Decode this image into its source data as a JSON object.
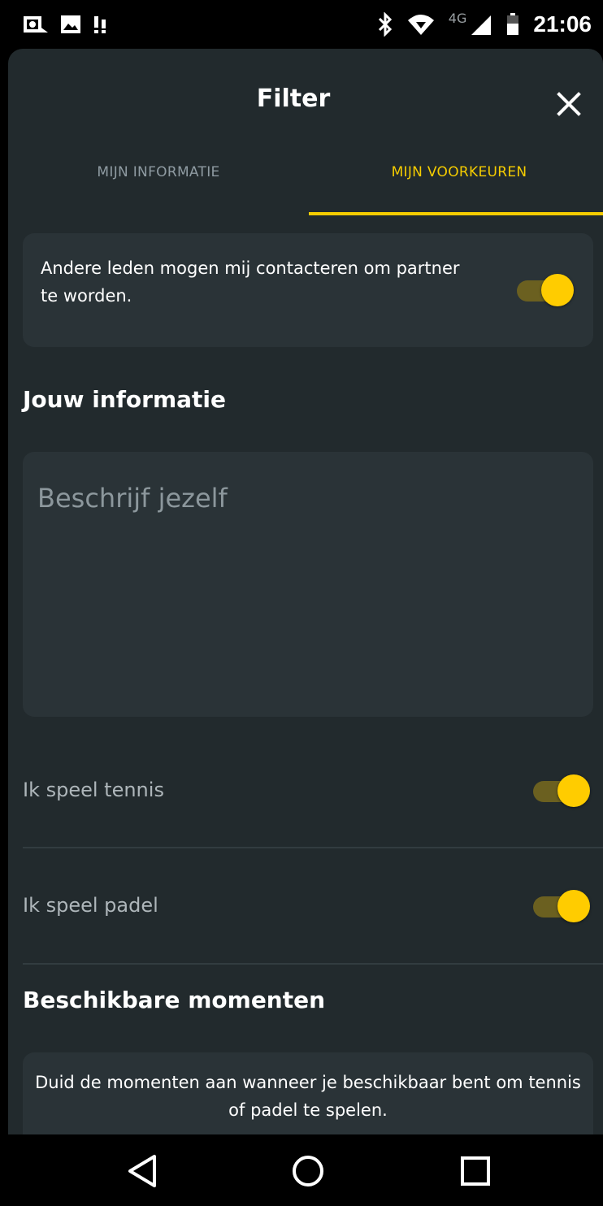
{
  "status_bar": {
    "time": "21:06",
    "network": "4G",
    "left_icons": [
      "camera-icon",
      "image-icon",
      "sim-icon"
    ],
    "right_icons": [
      "bluetooth-icon",
      "wifi-icon",
      "signal-icon",
      "battery-icon"
    ]
  },
  "header": {
    "title": "Filter",
    "close_icon": "close-icon"
  },
  "tabs": [
    {
      "label": "MIJN INFORMATIE",
      "active": false
    },
    {
      "label": "MIJN VOORKEUREN",
      "active": true
    }
  ],
  "contact_toggle": {
    "label": "Andere leden mogen mij contacteren om partner te worden.",
    "on": true
  },
  "your_info": {
    "heading": "Jouw informatie",
    "description_placeholder": "Beschrijf jezelf"
  },
  "sports": [
    {
      "label": "Ik speel tennis",
      "on": true
    },
    {
      "label": "Ik speel padel",
      "on": true
    }
  ],
  "availability": {
    "heading": "Beschikbare momenten",
    "info": "Duid de momenten aan wanneer je beschikbaar bent om tennis of padel te spelen."
  },
  "colors": {
    "accent": "#f5cc00",
    "background": "#222a2d",
    "card": "#2a3337"
  },
  "nav_bar": [
    "back-icon",
    "home-icon",
    "recents-icon"
  ]
}
